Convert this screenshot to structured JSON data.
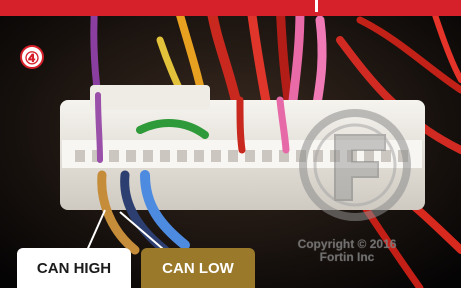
{
  "badge": {
    "text": "④"
  },
  "watermark": {
    "line1": "Copyright © 2016",
    "line2": "Fortin Inc"
  },
  "labels": {
    "can_high": "CAN HIGH",
    "can_low": "CAN LOW"
  },
  "colors": {
    "accent_red": "#d6202a",
    "can_high_bg": "#ffffff",
    "can_low_bg": "#9a7a2a",
    "connector": "#e9e6df"
  },
  "icons": {
    "watermark_logo": "fortin-f-logo"
  }
}
